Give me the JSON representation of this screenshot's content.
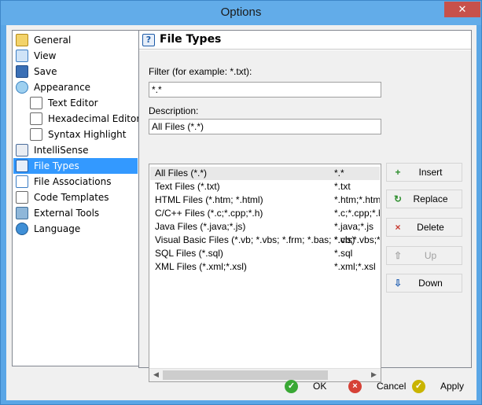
{
  "window": {
    "title": "Options",
    "close_glyph": "✕"
  },
  "sidebar": {
    "items": [
      {
        "label": "General",
        "icon": "general-icon"
      },
      {
        "label": "View",
        "icon": "view-icon"
      },
      {
        "label": "Save",
        "icon": "save-icon"
      },
      {
        "label": "Appearance",
        "icon": "appearance-icon"
      },
      {
        "label": "Text Editor",
        "icon": "text-editor-icon"
      },
      {
        "label": "Hexadecimal Editor",
        "icon": "hex-editor-icon"
      },
      {
        "label": "Syntax Highlight",
        "icon": "syntax-icon"
      },
      {
        "label": "IntelliSense",
        "icon": "intellisense-icon"
      },
      {
        "label": "File Types",
        "icon": "file-types-icon",
        "selected": true
      },
      {
        "label": "File Associations",
        "icon": "file-assoc-icon"
      },
      {
        "label": "Code Templates",
        "icon": "code-templates-icon"
      },
      {
        "label": "External Tools",
        "icon": "external-tools-icon"
      },
      {
        "label": "Language",
        "icon": "language-icon"
      }
    ]
  },
  "panel": {
    "title": "File Types",
    "filter_label": "Filter (for example: *.txt):",
    "filter_value": "*.*",
    "description_label": "Description:",
    "description_value": "All Files (*.*)",
    "list": [
      {
        "desc": "All Files (*.*)",
        "ext": "*.*"
      },
      {
        "desc": "Text Files (*.txt)",
        "ext": "*.txt"
      },
      {
        "desc": "HTML Files (*.htm; *.html)",
        "ext": "*.htm;*.html"
      },
      {
        "desc": "C/C++ Files (*.c;*.cpp;*.h)",
        "ext": "*.c;*.cpp;*.h"
      },
      {
        "desc": "Java Files (*.java;*.js)",
        "ext": "*.java;*.js"
      },
      {
        "desc": "Visual Basic Files (*.vb; *.vbs; *.frm; *.bas; *.cls)",
        "ext": "*.vb;*.vbs;*.frm"
      },
      {
        "desc": "SQL Files (*.sql)",
        "ext": "*.sql"
      },
      {
        "desc": "XML Files (*.xml;*.xsl)",
        "ext": "*.xml;*.xsl"
      }
    ],
    "buttons": {
      "insert": "Insert",
      "replace": "Replace",
      "delete": "Delete",
      "up": "Up",
      "down": "Down"
    }
  },
  "footer": {
    "ok": "OK",
    "cancel": "Cancel",
    "apply": "Apply"
  },
  "colors": {
    "selection": "#3399ff",
    "title_bar": "#62ace9",
    "ok_green": "#3aa835",
    "cancel_red": "#d64136",
    "apply_yellow": "#c9b400"
  }
}
